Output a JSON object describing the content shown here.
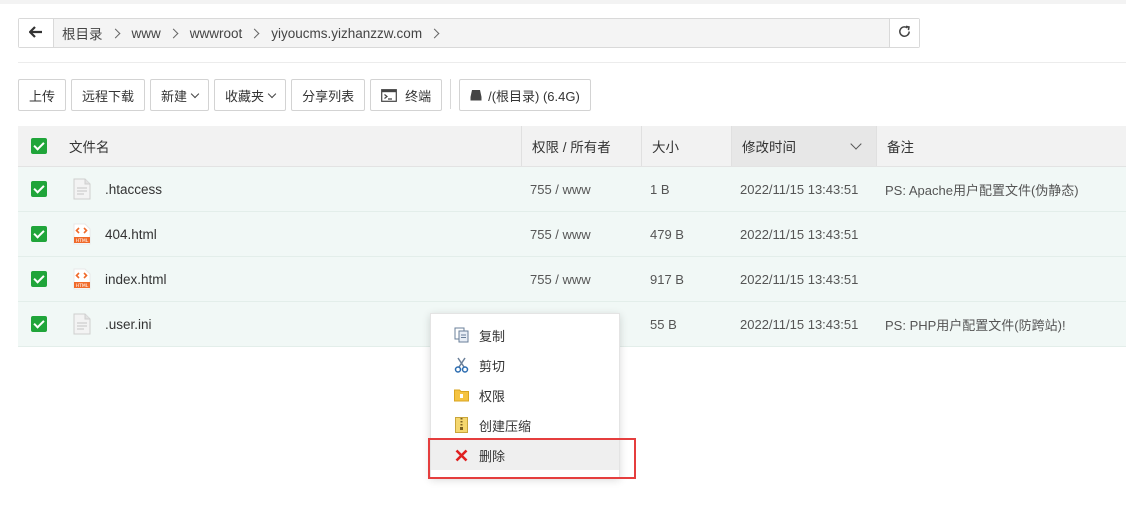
{
  "breadcrumb": {
    "items": [
      "根目录",
      "www",
      "wwwroot",
      "yiyoucms.yizhanzzw.com"
    ]
  },
  "toolbar": {
    "upload": "上传",
    "remote_download": "远程下载",
    "new": "新建",
    "favorites": "收藏夹",
    "share_list": "分享列表",
    "terminal": "终端",
    "disk": "/(根目录) (6.4G)"
  },
  "table": {
    "headers": {
      "name": "文件名",
      "perm": "权限 / 所有者",
      "size": "大小",
      "mtime": "修改时间",
      "note": "备注"
    },
    "rows": [
      {
        "name": ".htaccess",
        "type": "text",
        "perm": "755 / www",
        "size": "1 B",
        "mtime": "2022/11/15 13:43:51",
        "note": "PS: Apache用户配置文件(伪静态)"
      },
      {
        "name": "404.html",
        "type": "html",
        "perm": "755 / www",
        "size": "479 B",
        "mtime": "2022/11/15 13:43:51",
        "note": ""
      },
      {
        "name": "index.html",
        "type": "html",
        "perm": "755 / www",
        "size": "917 B",
        "mtime": "2022/11/15 13:43:51",
        "note": ""
      },
      {
        "name": ".user.ini",
        "type": "text",
        "perm": "",
        "size": "55 B",
        "mtime": "2022/11/15 13:43:51",
        "note": "PS: PHP用户配置文件(防跨站)!"
      }
    ]
  },
  "context_menu": {
    "copy": "复制",
    "cut": "剪切",
    "permission": "权限",
    "compress": "创建压缩",
    "delete": "删除"
  },
  "colors": {
    "accent_green": "#20a53a",
    "row_bg": "#f1f8f6",
    "delete_red": "#e02020",
    "highlight_border": "#e53e3e"
  }
}
